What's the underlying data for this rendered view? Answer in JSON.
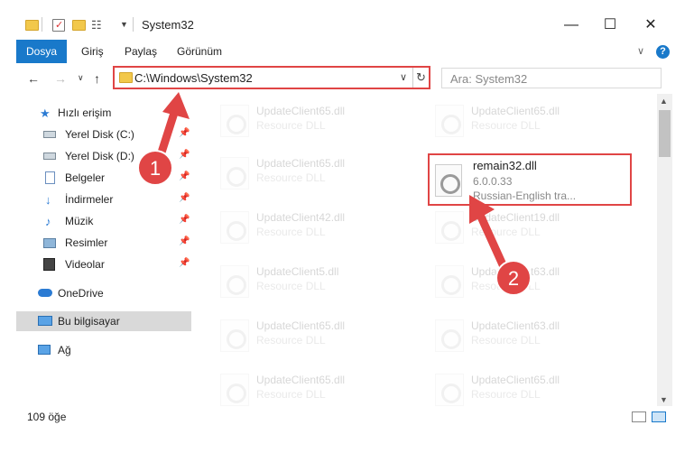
{
  "window": {
    "title": "System32",
    "minimize": "—",
    "maximize": "☐",
    "close": "✕"
  },
  "ribbon": {
    "tabs": [
      "Dosya",
      "Giriş",
      "Paylaş",
      "Görünüm"
    ]
  },
  "address": {
    "path": "C:\\Windows\\System32"
  },
  "search": {
    "placeholder": "Ara: System32"
  },
  "sidebar": {
    "items": [
      {
        "label": "Hızlı erişim",
        "icon": "star-icon"
      },
      {
        "label": "Yerel Disk (C:)",
        "icon": "drive-icon"
      },
      {
        "label": "Yerel Disk (D:)",
        "icon": "drive-icon"
      },
      {
        "label": "Belgeler",
        "icon": "documents-icon"
      },
      {
        "label": "İndirmeler",
        "icon": "download-icon"
      },
      {
        "label": "Müzik",
        "icon": "music-icon"
      },
      {
        "label": "Resimler",
        "icon": "pictures-icon"
      },
      {
        "label": "Videolar",
        "icon": "video-icon"
      },
      {
        "label": "OneDrive",
        "icon": "cloud-icon"
      },
      {
        "label": "Bu bilgisayar",
        "icon": "computer-icon"
      },
      {
        "label": "Ağ",
        "icon": "network-icon"
      }
    ]
  },
  "files": [
    {
      "name": "UpdateClient65.dll",
      "desc": "Resource DLL"
    },
    {
      "name": "UpdateClient65.dll",
      "desc": "Resource DLL"
    },
    {
      "name": "UpdateClient65.dll",
      "desc": "Resource DLL"
    },
    {
      "name": "UpdateClient42.dll",
      "desc": "Resource DLL"
    },
    {
      "name": "UpdateClient19.dll",
      "desc": "Resource DLL"
    },
    {
      "name": "UpdateClient5.dll",
      "desc": "Resource DLL"
    },
    {
      "name": "UpdateClient63.dll",
      "desc": "Resource DLL"
    },
    {
      "name": "UpdateClient65.dll",
      "desc": "Resource DLL"
    },
    {
      "name": "UpdateClient63.dll",
      "desc": "Resource DLL"
    },
    {
      "name": "UpdateClient65.dll",
      "desc": "Resource DLL"
    },
    {
      "name": "UpdateClient65.dll",
      "desc": "Resource DLL"
    }
  ],
  "highlighted_file": {
    "name": "remain32.dll",
    "version": "6.0.0.33",
    "desc": "Russian-English tra..."
  },
  "status": {
    "count": "109 öğe"
  },
  "annotations": {
    "step1": "1",
    "step2": "2",
    "color": "#e04545"
  }
}
